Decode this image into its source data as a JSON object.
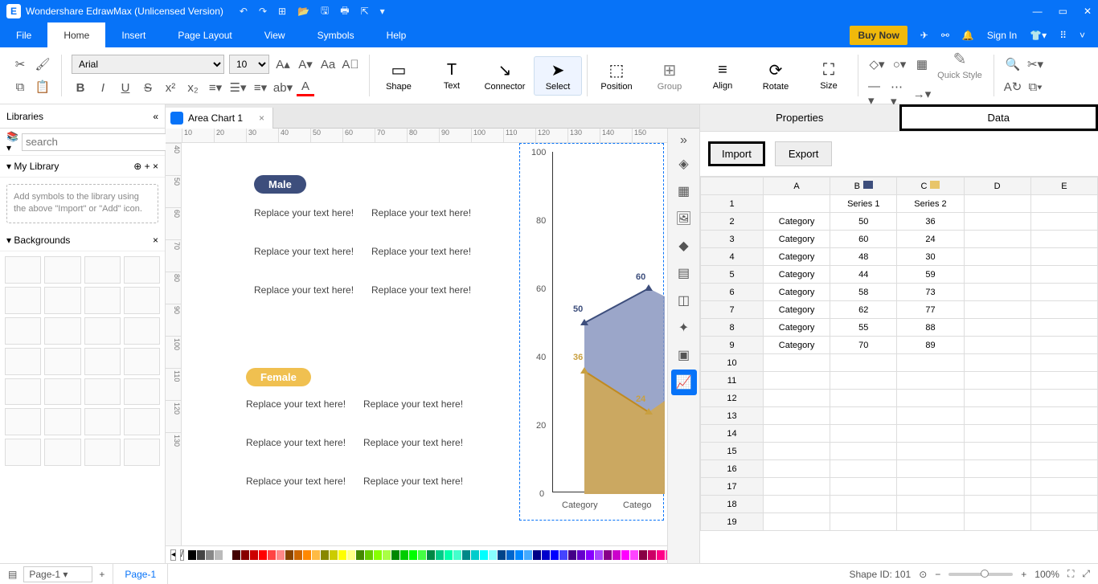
{
  "app": {
    "title": "Wondershare EdrawMax (Unlicensed Version)"
  },
  "menus": {
    "file": "File",
    "home": "Home",
    "insert": "Insert",
    "page_layout": "Page Layout",
    "view": "View",
    "symbols": "Symbols",
    "help": "Help",
    "buy_now": "Buy Now",
    "sign_in": "Sign In"
  },
  "ribbon": {
    "font_family": "Arial",
    "font_size": "10",
    "groups": {
      "shape": "Shape",
      "text": "Text",
      "connector": "Connector",
      "select": "Select",
      "position": "Position",
      "group": "Group",
      "align": "Align",
      "rotate": "Rotate",
      "size": "Size",
      "quick_style": "Quick Style"
    }
  },
  "left": {
    "title": "Libraries",
    "search_placeholder": "search",
    "mylib": "My Library",
    "note": "Add symbols to the library using the above \"Import\" or \"Add\" icon.",
    "backgrounds": "Backgrounds"
  },
  "doc": {
    "tab": "Area Chart 1"
  },
  "hruler": [
    "10",
    "20",
    "30",
    "40",
    "50",
    "60",
    "70",
    "80",
    "90",
    "100",
    "110",
    "120",
    "130",
    "140",
    "150"
  ],
  "vruler": [
    "40",
    "50",
    "60",
    "70",
    "80",
    "90",
    "100",
    "110",
    "120",
    "130"
  ],
  "canvas": {
    "pill_male": "Male",
    "pill_female": "Female",
    "placeholder": "Replace your text here!"
  },
  "chart_data": {
    "type": "area",
    "categories": [
      "Category",
      "Category",
      "Category",
      "Category",
      "Category",
      "Category",
      "Category",
      "Category"
    ],
    "series": [
      {
        "name": "Series 1",
        "values": [
          50,
          60,
          48,
          44,
          58,
          62,
          55,
          70
        ],
        "color": "#5a6fa1"
      },
      {
        "name": "Series 2",
        "values": [
          36,
          24,
          30,
          59,
          73,
          77,
          88,
          89
        ],
        "color": "#cfa048"
      }
    ],
    "ylim": [
      0,
      100
    ],
    "yticks": [
      0,
      20,
      40,
      60,
      80,
      100
    ],
    "visible_markers": {
      "s1": [
        50,
        60
      ],
      "s2": [
        36,
        24
      ]
    },
    "xlabel": "",
    "ylabel": ""
  },
  "rpanel": {
    "tab_props": "Properties",
    "tab_data": "Data",
    "import": "Import",
    "export": "Export",
    "cols": [
      "A",
      "B",
      "C",
      "D",
      "E"
    ],
    "head": {
      "b": "Series 1",
      "c": "Series 2"
    },
    "rows": [
      {
        "n": "2",
        "a": "Category",
        "b": "50",
        "c": "36"
      },
      {
        "n": "3",
        "a": "Category",
        "b": "60",
        "c": "24"
      },
      {
        "n": "4",
        "a": "Category",
        "b": "48",
        "c": "30"
      },
      {
        "n": "5",
        "a": "Category",
        "b": "44",
        "c": "59"
      },
      {
        "n": "6",
        "a": "Category",
        "b": "58",
        "c": "73"
      },
      {
        "n": "7",
        "a": "Category",
        "b": "62",
        "c": "77"
      },
      {
        "n": "8",
        "a": "Category",
        "b": "55",
        "c": "88"
      },
      {
        "n": "9",
        "a": "Category",
        "b": "70",
        "c": "89"
      }
    ],
    "extra_rows": [
      "10",
      "11",
      "12",
      "13",
      "14",
      "15",
      "16",
      "17",
      "18",
      "19"
    ]
  },
  "status": {
    "page_sel": "Page-1",
    "page_tab": "Page-1",
    "shape_id": "Shape ID: 101",
    "zoom": "100%"
  }
}
